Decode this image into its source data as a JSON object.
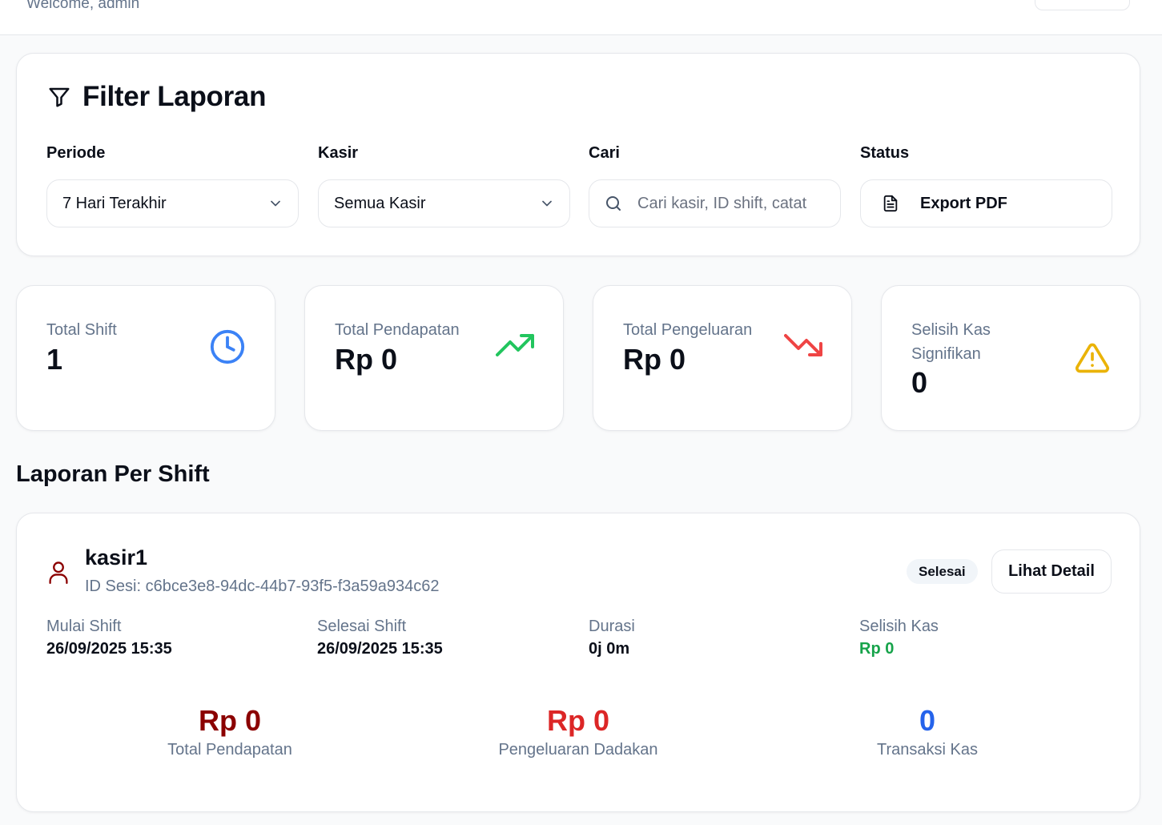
{
  "header": {
    "welcome": "Welcome, admin"
  },
  "filter": {
    "title": "Filter Laporan",
    "periode_label": "Periode",
    "periode_value": "7 Hari Terakhir",
    "kasir_label": "Kasir",
    "kasir_value": "Semua Kasir",
    "cari_label": "Cari",
    "cari_placeholder": "Cari kasir, ID shift, catat",
    "status_label": "Status",
    "export_label": "Export PDF"
  },
  "stats": [
    {
      "label": "Total Shift",
      "value": "1",
      "icon": "clock-icon"
    },
    {
      "label": "Total Pendapatan",
      "value": "Rp 0",
      "icon": "trending-up-icon"
    },
    {
      "label": "Total Pengeluaran",
      "value": "Rp 0",
      "icon": "trending-down-icon"
    },
    {
      "label": "Selisih Kas Signifikan",
      "value": "0",
      "icon": "warning-icon"
    }
  ],
  "section_title": "Laporan Per Shift",
  "shift": {
    "cashier": "kasir1",
    "session_id": "ID Sesi: c6bce3e8-94dc-44b7-93f5-f3a59a934c62",
    "status_badge": "Selesai",
    "detail_button": "Lihat Detail",
    "meta": [
      {
        "label": "Mulai Shift",
        "value": "26/09/2025 15:35"
      },
      {
        "label": "Selesai Shift",
        "value": "26/09/2025 15:35"
      },
      {
        "label": "Durasi",
        "value": "0j 0m"
      },
      {
        "label": "Selisih Kas",
        "value": "Rp 0"
      }
    ],
    "summary": [
      {
        "value": "Rp 0",
        "label": "Total Pendapatan"
      },
      {
        "value": "Rp 0",
        "label": "Pengeluaran Dadakan"
      },
      {
        "value": "0",
        "label": "Transaksi Kas"
      }
    ]
  },
  "colors": {
    "income": "#8b0000",
    "expense": "#dc2626",
    "transaction": "#2563eb",
    "positive": "#16a34a",
    "clock": "#3b82f6",
    "warning": "#eab308"
  }
}
